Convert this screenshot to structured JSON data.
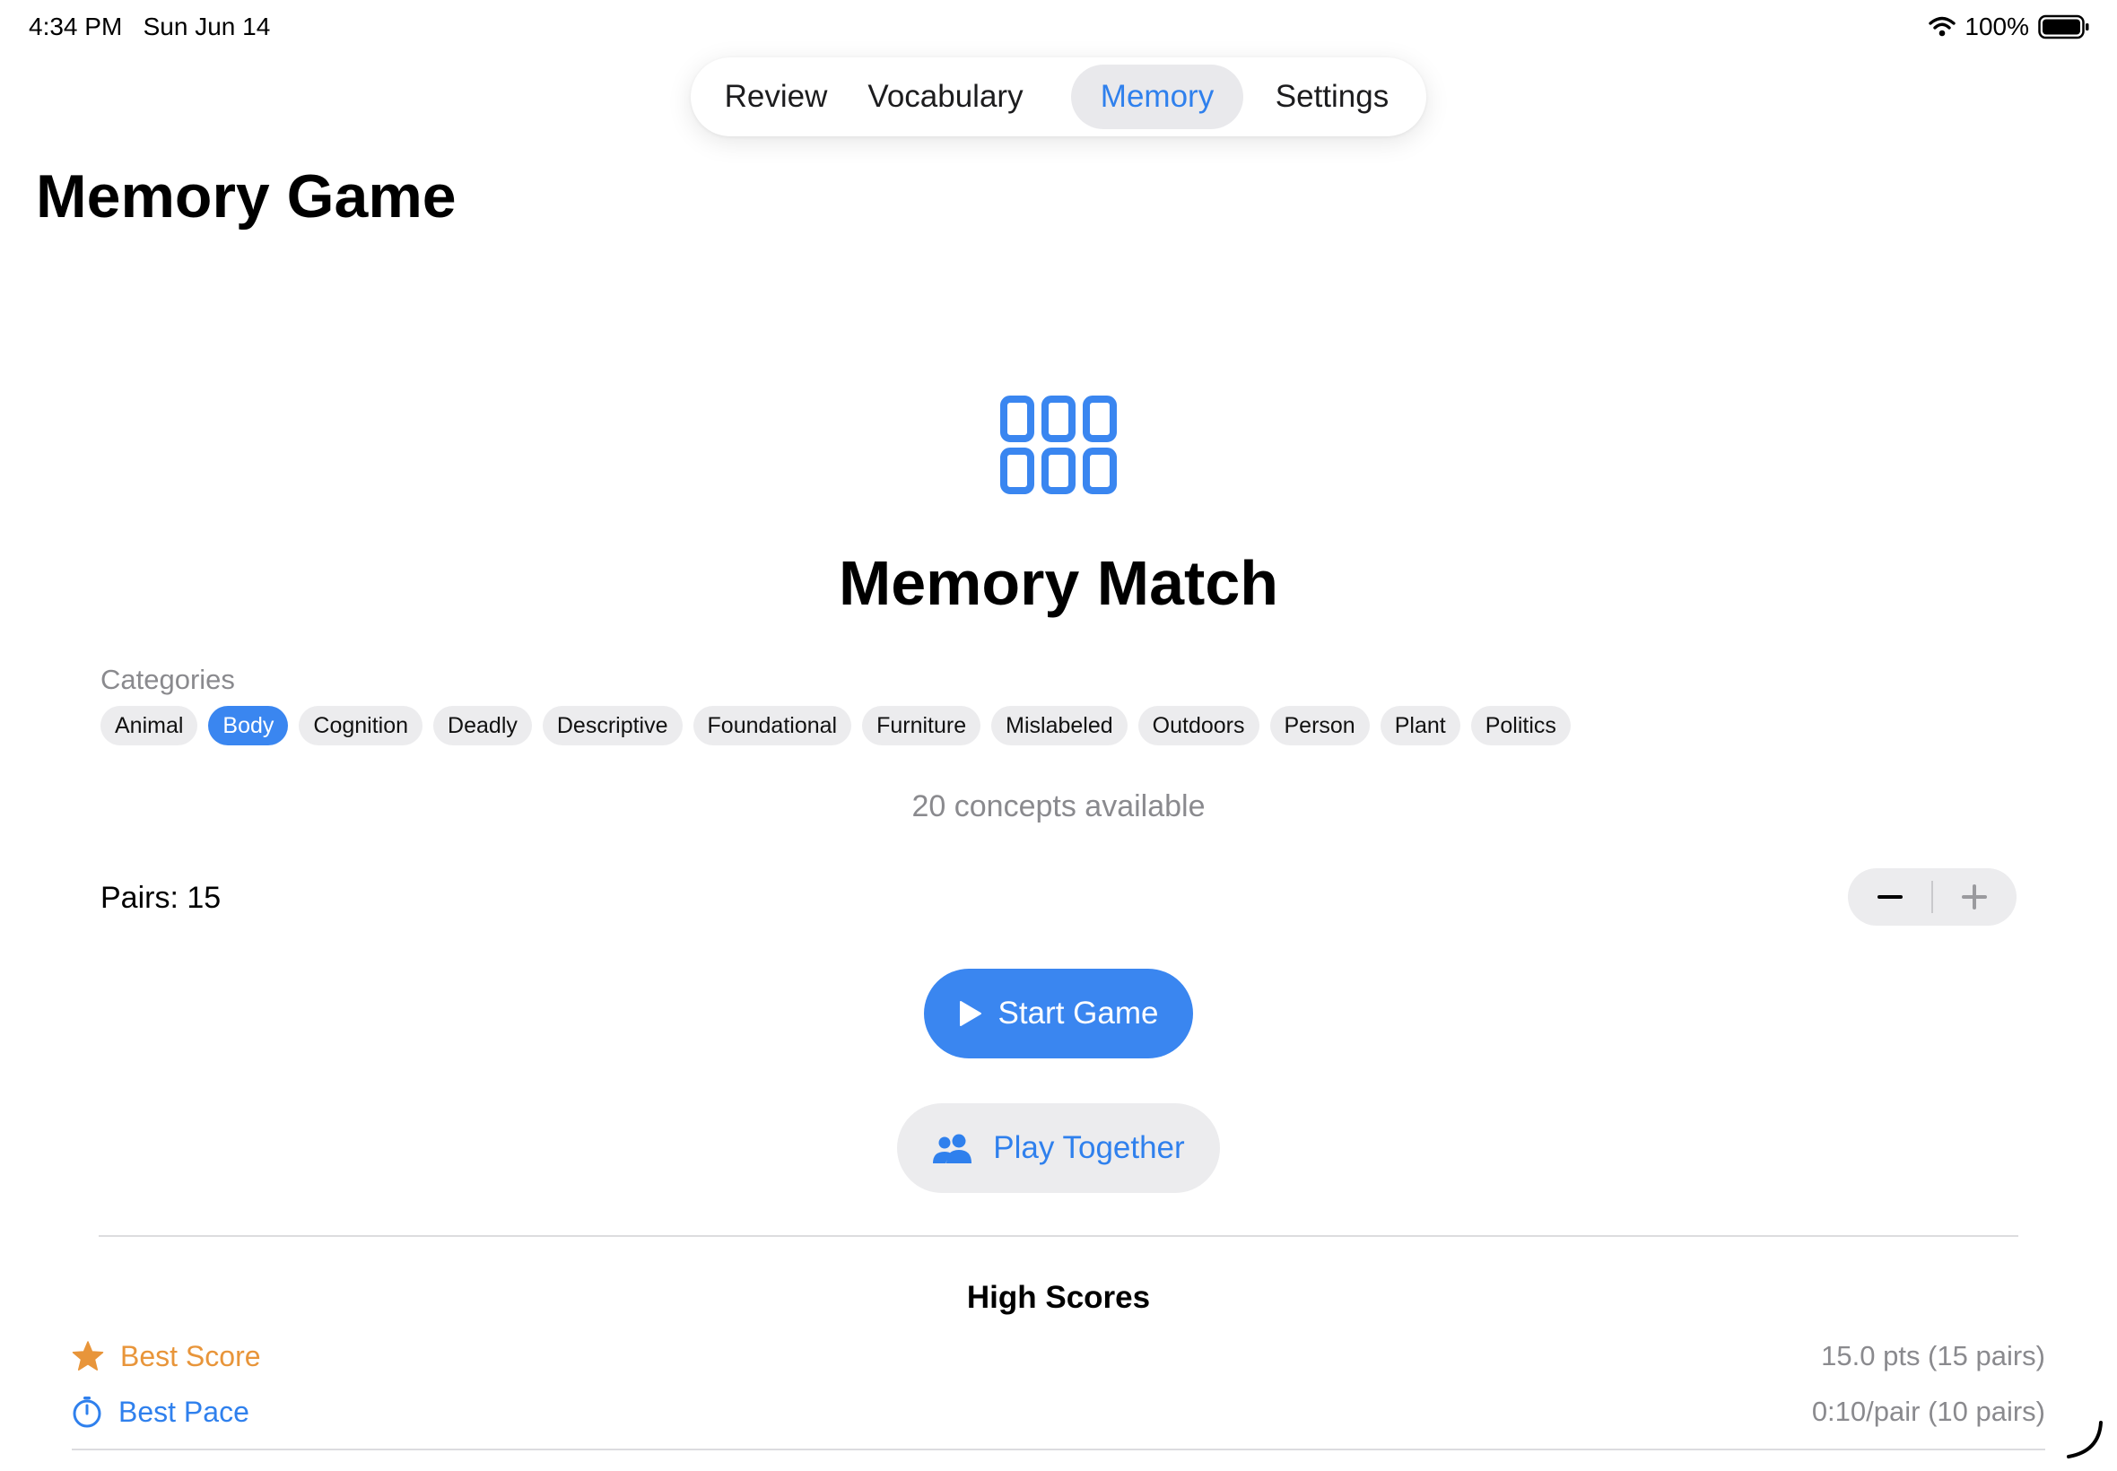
{
  "status_bar": {
    "time": "4:34 PM",
    "date": "Sun Jun 14",
    "battery": "100%"
  },
  "nav": {
    "tabs": [
      {
        "label": "Review",
        "active": false
      },
      {
        "label": "Vocabulary",
        "active": false
      },
      {
        "label": "Memory",
        "active": true
      },
      {
        "label": "Settings",
        "active": false
      }
    ]
  },
  "page": {
    "title": "Memory Game"
  },
  "game": {
    "icon": "grid-cards-icon",
    "title": "Memory Match"
  },
  "categories": {
    "label": "Categories",
    "items": [
      {
        "label": "Animal",
        "selected": false
      },
      {
        "label": "Body",
        "selected": true
      },
      {
        "label": "Cognition",
        "selected": false
      },
      {
        "label": "Deadly",
        "selected": false
      },
      {
        "label": "Descriptive",
        "selected": false
      },
      {
        "label": "Foundational",
        "selected": false
      },
      {
        "label": "Furniture",
        "selected": false
      },
      {
        "label": "Mislabeled",
        "selected": false
      },
      {
        "label": "Outdoors",
        "selected": false
      },
      {
        "label": "Person",
        "selected": false
      },
      {
        "label": "Plant",
        "selected": false
      },
      {
        "label": "Politics",
        "selected": false
      }
    ],
    "available_text": "20 concepts available"
  },
  "pairs": {
    "label": "Pairs: 15"
  },
  "actions": {
    "start_label": "Start Game",
    "together_label": "Play Together"
  },
  "high_scores": {
    "title": "High Scores",
    "rows": [
      {
        "label": "Best Score",
        "value": "15.0 pts (15 pairs)",
        "icon": "star-icon",
        "color": "#e8953a"
      },
      {
        "label": "Best Pace",
        "value": "0:10/pair (10 pairs)",
        "icon": "timer-icon",
        "color": "#2f80ed"
      }
    ]
  },
  "colors": {
    "accent": "#3a86f0",
    "accent_text": "#2f80ed",
    "star": "#e8953a",
    "muted": "#8a8a8e"
  }
}
